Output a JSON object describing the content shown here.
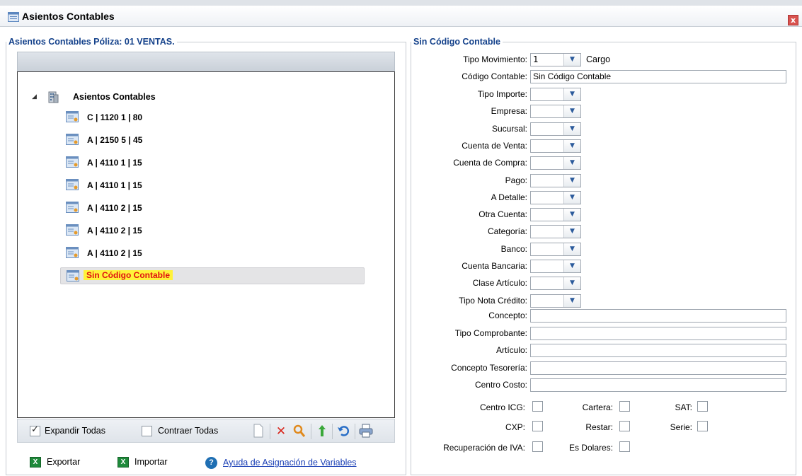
{
  "window": {
    "title": "Asientos Contables",
    "close_label": "x"
  },
  "left_panel": {
    "legend": "Asientos Contables Póliza: 01 VENTAS.",
    "tree": {
      "root_label": "Asientos Contables",
      "items": [
        "C | 1120 1 | 80",
        "A | 2150 5 | 45",
        "A | 4110 1 | 15",
        "A | 4110 1 | 15",
        "A | 4110 2 | 15",
        "A | 4110 2 | 15",
        "A | 4110 2 | 15",
        "Sin Código Contable"
      ],
      "selected_index": 7
    },
    "bottom_bar": {
      "expand_label": "Expandir Todas",
      "expand_checked": true,
      "collapse_label": "Contraer Todas",
      "collapse_checked": false
    },
    "footer": {
      "export_label": "Exportar",
      "import_label": "Importar",
      "help_link": "Ayuda de Asignación de Variables"
    }
  },
  "right_panel": {
    "legend": "Sin Código Contable",
    "tipo_movimiento": {
      "label": "Tipo Movimiento:",
      "value": "1",
      "suffix": "Cargo"
    },
    "codigo_contable": {
      "label": "Código Contable:",
      "value": "Sin Código Contable"
    },
    "combo_fields": [
      {
        "label": "Tipo Importe:",
        "value": ""
      },
      {
        "label": "Empresa:",
        "value": ""
      },
      {
        "label": "Sucursal:",
        "value": ""
      },
      {
        "label": "Cuenta de Venta:",
        "value": ""
      },
      {
        "label": "Cuenta de Compra:",
        "value": ""
      },
      {
        "label": "Pago:",
        "value": ""
      },
      {
        "label": "A Detalle:",
        "value": ""
      },
      {
        "label": "Otra Cuenta:",
        "value": ""
      },
      {
        "label": "Categoría:",
        "value": ""
      },
      {
        "label": "Banco:",
        "value": ""
      },
      {
        "label": "Cuenta Bancaria:",
        "value": ""
      },
      {
        "label": "Clase Artículo:",
        "value": ""
      },
      {
        "label": "Tipo Nota Crédito:",
        "value": ""
      }
    ],
    "text_fields": [
      {
        "label": "Concepto:",
        "value": ""
      },
      {
        "label": "Tipo Comprobante:",
        "value": ""
      },
      {
        "label": "Artículo:",
        "value": ""
      },
      {
        "label": "Concepto Tesorería:",
        "value": ""
      },
      {
        "label": "Centro Costo:",
        "value": ""
      }
    ],
    "checkboxes": {
      "centro_icg": {
        "label": "Centro ICG:",
        "checked": false
      },
      "cartera": {
        "label": "Cartera:",
        "checked": false
      },
      "sat": {
        "label": "SAT:",
        "checked": false
      },
      "cxp": {
        "label": "CXP:",
        "checked": false
      },
      "restar": {
        "label": "Restar:",
        "checked": false
      },
      "serie": {
        "label": "Serie:",
        "checked": false
      },
      "recuperacion_iva": {
        "label": "Recuperación de IVA:",
        "checked": false
      },
      "es_dolares": {
        "label": "Es Dolares:",
        "checked": false
      }
    }
  },
  "icons": {
    "window": "grid-window-icon",
    "tree_root": "building-icon",
    "tree_node": "ledger-entry-icon",
    "new": "new-document-icon",
    "delete": "delete-x-icon",
    "search": "magnifier-icon",
    "move_up": "arrow-up-icon",
    "undo": "undo-icon",
    "print": "printer-icon",
    "excel": "excel-icon",
    "help": "help-question-icon"
  },
  "colors": {
    "legend": "#15428b",
    "selected_text": "#e01010",
    "highlight": "#fff23a",
    "link": "#1a3fb5"
  }
}
